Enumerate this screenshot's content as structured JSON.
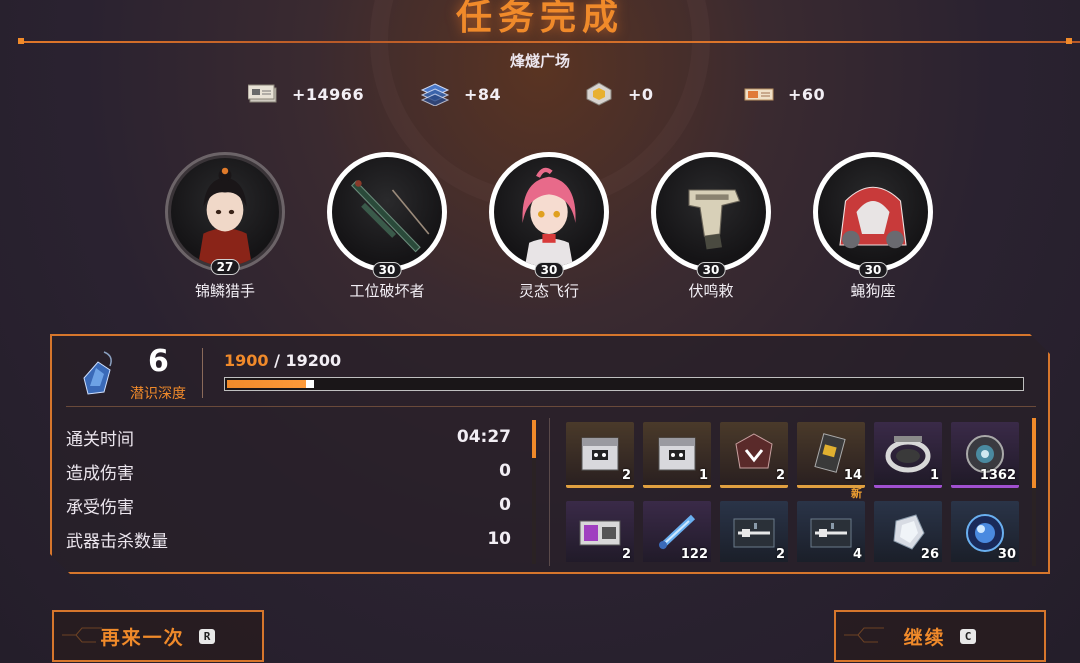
{
  "header": {
    "title": "任务完成",
    "location": "烽燧广场"
  },
  "currencies": [
    {
      "icon": "banknote-icon",
      "value": "+14966"
    },
    {
      "icon": "data-chip-stack-icon",
      "value": "+84"
    },
    {
      "icon": "gold-crystal-icon",
      "value": "+0"
    },
    {
      "icon": "ticket-icon",
      "value": "+60"
    }
  ],
  "characters": [
    {
      "name": "锦鳞猎手",
      "level": "27"
    },
    {
      "name": "工位破坏者",
      "level": "30"
    },
    {
      "name": "灵态飞行",
      "level": "30"
    },
    {
      "name": "伏鸣敕",
      "level": "30"
    },
    {
      "name": "蝇狗座",
      "level": "30"
    }
  ],
  "panel": {
    "dive_level": "6",
    "dive_label": "潜识深度",
    "xp_current": "1900",
    "xp_separator": " / ",
    "xp_max": "19200",
    "xp_fraction": 0.099,
    "stats": [
      {
        "label": "通关时间",
        "value": "04:27"
      },
      {
        "label": "造成伤害",
        "value": "0"
      },
      {
        "label": "承受伤害",
        "value": "0"
      },
      {
        "label": "武器击杀数量",
        "value": "10"
      }
    ],
    "items": [
      {
        "icon": "supply-crate-icon",
        "count": "2",
        "rarity": "gold"
      },
      {
        "icon": "supply-crate-icon",
        "count": "1",
        "rarity": "gold"
      },
      {
        "icon": "emblem-badge-icon",
        "count": "2",
        "rarity": "gold"
      },
      {
        "icon": "card-chip-icon",
        "count": "14",
        "rarity": "gold"
      },
      {
        "icon": "ring-module-icon",
        "count": "1",
        "rarity": "purple"
      },
      {
        "icon": "gear-core-icon",
        "count": "1362",
        "rarity": "purple"
      },
      {
        "icon": "battery-module-icon",
        "count": "2",
        "rarity": "purple"
      },
      {
        "icon": "syringe-icon",
        "count": "122",
        "rarity": "purple"
      },
      {
        "icon": "weapon-schematic-icon",
        "count": "2",
        "rarity": "blue"
      },
      {
        "icon": "weapon-schematic-icon",
        "count": "4",
        "rarity": "blue",
        "badge": "新"
      },
      {
        "icon": "crystal-shard-icon",
        "count": "26",
        "rarity": "blue"
      },
      {
        "icon": "orb-core-icon",
        "count": "30",
        "rarity": "blue"
      }
    ]
  },
  "buttons": {
    "retry_label": "再来一次",
    "retry_key": "R",
    "continue_label": "继续",
    "continue_key": "C"
  },
  "colors": {
    "accent": "#f08a2a",
    "panel_border": "#d6762c"
  }
}
